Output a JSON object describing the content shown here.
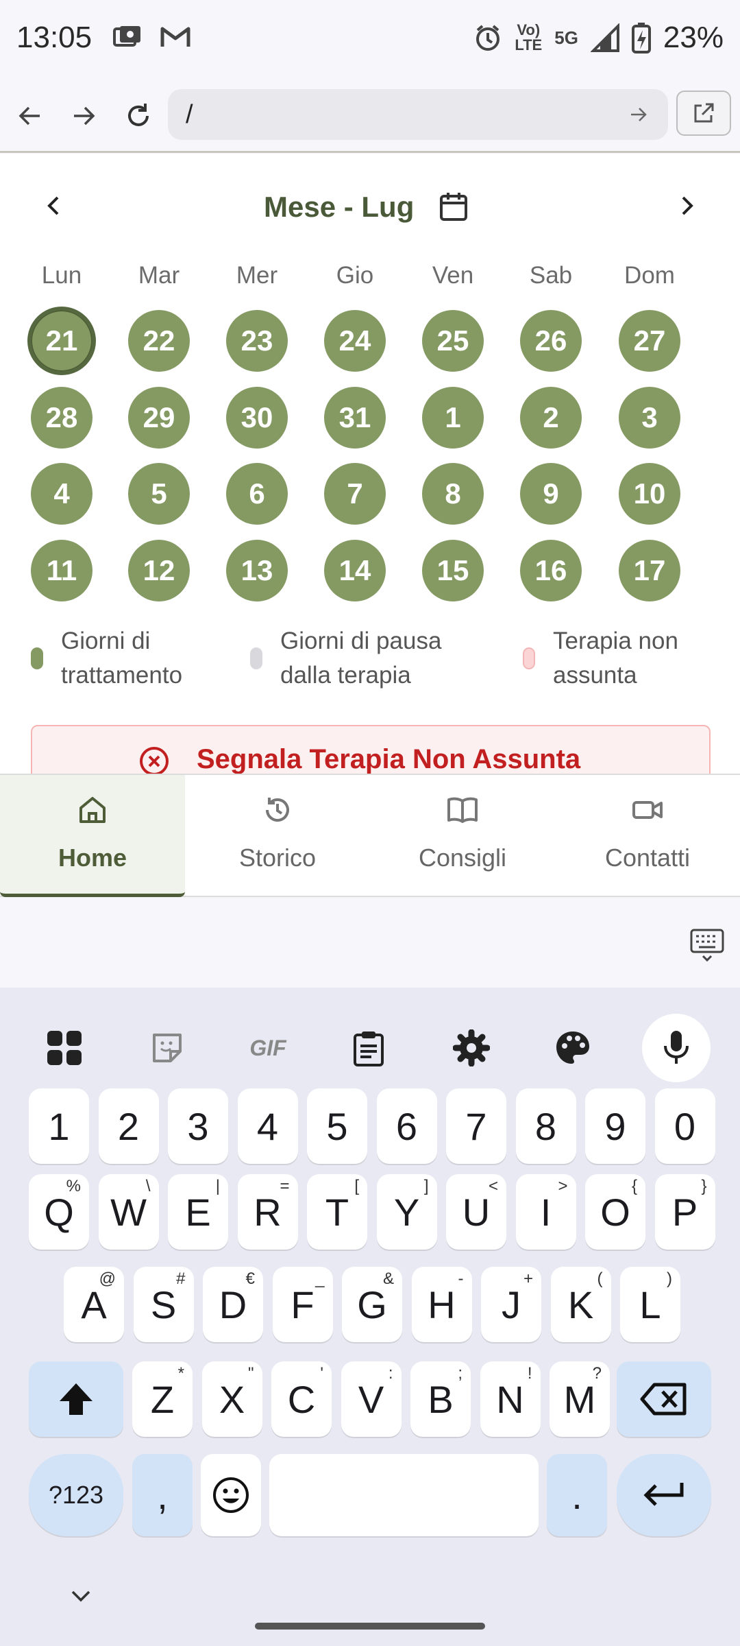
{
  "status": {
    "time": "13:05",
    "net_top": "Vo)",
    "net_bottom": "LTE",
    "net5g": "5G",
    "battery": "23%"
  },
  "browser": {
    "url": "/"
  },
  "calendar": {
    "title": "Mese - Lug",
    "weekdays": [
      "Lun",
      "Mar",
      "Mer",
      "Gio",
      "Ven",
      "Sab",
      "Dom"
    ],
    "weeks": [
      [
        "21",
        "22",
        "23",
        "24",
        "25",
        "26",
        "27"
      ],
      [
        "28",
        "29",
        "30",
        "31",
        "1",
        "2",
        "3"
      ],
      [
        "4",
        "5",
        "6",
        "7",
        "8",
        "9",
        "10"
      ],
      [
        "11",
        "12",
        "13",
        "14",
        "15",
        "16",
        "17"
      ]
    ],
    "legend": [
      {
        "label": "Giorni di trattamento",
        "color": "#859a63"
      },
      {
        "label": "Giorni di pausa dalla terapia",
        "color": "#d9d9dd"
      },
      {
        "label": "Terapia non assunta",
        "color": "#fbd5d5"
      }
    ],
    "alert_label": "Segnala Terapia Non Assunta"
  },
  "nav": {
    "tabs": [
      {
        "label": "Home",
        "icon": "home-icon"
      },
      {
        "label": "Storico",
        "icon": "history-icon"
      },
      {
        "label": "Consigli",
        "icon": "book-icon"
      },
      {
        "label": "Contatti",
        "icon": "video-icon"
      }
    ]
  },
  "keyboard": {
    "toolbar": [
      "apps-icon",
      "sticker-icon",
      "gif-icon",
      "clipboard-icon",
      "settings-icon",
      "palette-icon",
      "mic-icon"
    ],
    "gif_label": "GIF",
    "row1": [
      "1",
      "2",
      "3",
      "4",
      "5",
      "6",
      "7",
      "8",
      "9",
      "0"
    ],
    "row2": [
      [
        "Q",
        "%"
      ],
      [
        "W",
        "\\"
      ],
      [
        "E",
        "|"
      ],
      [
        "R",
        "="
      ],
      [
        "T",
        "["
      ],
      [
        "Y",
        "]"
      ],
      [
        "U",
        "<"
      ],
      [
        "I",
        ">"
      ],
      [
        "O",
        "{"
      ],
      [
        "P",
        "}"
      ]
    ],
    "row3": [
      [
        "A",
        "@"
      ],
      [
        "S",
        "#"
      ],
      [
        "D",
        "€"
      ],
      [
        "F",
        "_"
      ],
      [
        "G",
        "&"
      ],
      [
        "H",
        "-"
      ],
      [
        "J",
        "+"
      ],
      [
        "K",
        "("
      ],
      [
        "L",
        ")"
      ]
    ],
    "row4": [
      [
        "Z",
        "*"
      ],
      [
        "X",
        "\""
      ],
      [
        "C",
        "'"
      ],
      [
        "V",
        ":"
      ],
      [
        "B",
        ";"
      ],
      [
        "N",
        "!"
      ],
      [
        "M",
        "?"
      ]
    ],
    "symbols_label": "?123",
    "comma": ",",
    "period": "."
  }
}
